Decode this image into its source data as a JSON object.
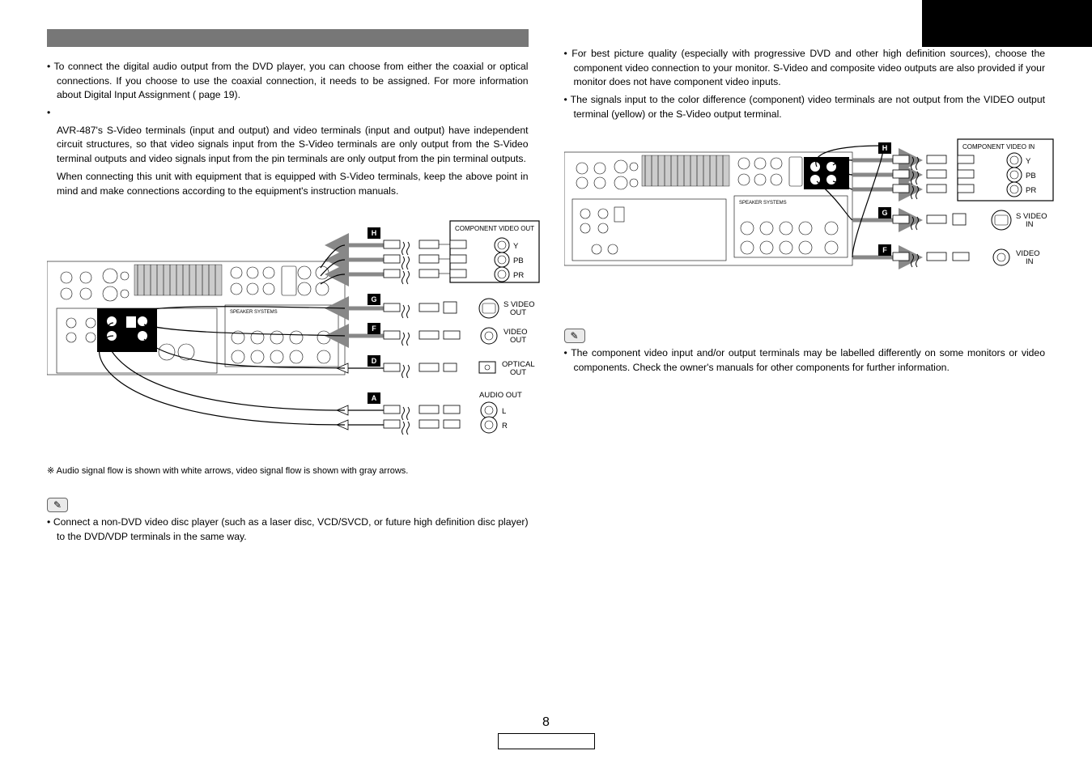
{
  "page_number": "8",
  "left": {
    "b1": "To connect the digital audio output from the DVD player, you can choose from either the coaxial or optical connections. If you choose to use the coaxial connection, it needs to be assigned. For more information about Digital Input Assignment (      page 19).",
    "b2a": "AVR-487's S-Video terminals (input and output) and video terminals (input and output) have independent circuit structures, so that video signals input from the S-Video terminals are only output from the S-Video terminal outputs and video signals input from the pin terminals are only output from the pin terminal outputs.",
    "b2b": "When connecting this unit with equipment that is equipped with S-Video terminals, keep the above point in mind and make connections according to the equipment's instruction manuals.",
    "footnote": "※ Audio signal flow is shown with white arrows, video signal flow is shown with gray arrows.",
    "note": "Connect a non-DVD video disc player (such as a laser disc, VCD/SVCD, or future high definition disc player) to the DVD/VDP terminals in the same way.",
    "diag": {
      "panel_title": "COMPONENT VIDEO OUT",
      "y": "Y",
      "pb": "PB",
      "pr": "PR",
      "svideo": "S VIDEO",
      "svideo2": "OUT",
      "video": "VIDEO",
      "video2": "OUT",
      "optical": "OPTICAL",
      "optical2": "OUT",
      "audio": "AUDIO OUT",
      "l": "L",
      "r": "R",
      "tagH": "H",
      "tagG": "G",
      "tagF": "F",
      "tagD": "D",
      "tagA": "A"
    }
  },
  "right": {
    "b1": "For best picture quality (especially with progressive DVD and other high definition sources), choose the component video connection to your monitor. S-Video and composite video outputs are also provided if your monitor does not have component video inputs.",
    "b2": "The signals input to the color difference (component) video terminals are not output from the VIDEO output terminal (yellow) or the S-Video output terminal.",
    "note": "The component video input and/or output terminals may be labelled differently on some monitors or video components. Check the owner's manuals for other components for further information.",
    "diag": {
      "panel_title": "COMPONENT VIDEO IN",
      "y": "Y",
      "pb": "PB",
      "pr": "PR",
      "svideo": "S VIDEO",
      "svideo2": "IN",
      "video": "VIDEO",
      "video2": "IN",
      "tagH": "H",
      "tagG": "G",
      "tagF": "F"
    }
  }
}
